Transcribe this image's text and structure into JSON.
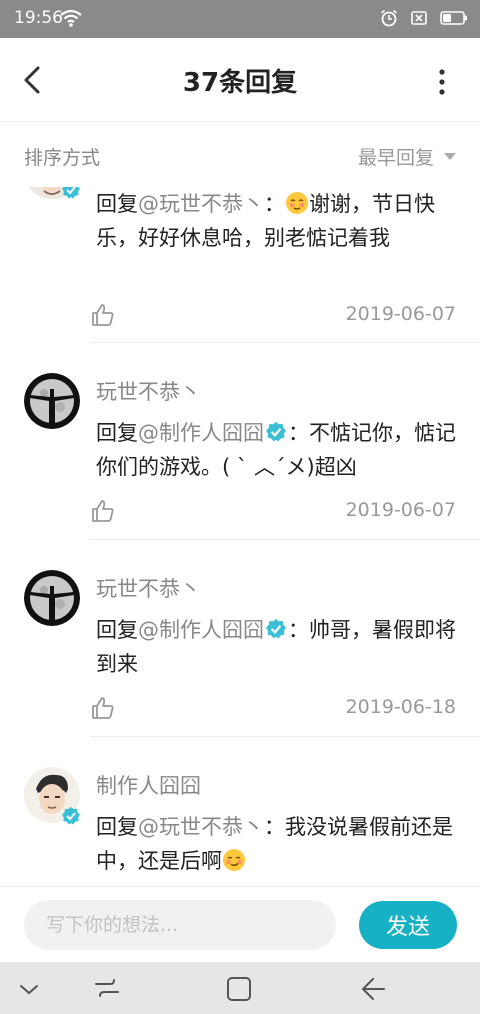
{
  "status": {
    "time": "19:56"
  },
  "header": {
    "title": "37条回复"
  },
  "sort": {
    "label": "排序方式",
    "selected": "最早回复"
  },
  "comments": [
    {
      "body_prefix": "回复",
      "mention": "@玩世不恭丶",
      "body_sep": "：",
      "body_text_line1": "谢谢，节",
      "body_text_rest": "日快乐，好好休息哈，别老惦记着我",
      "date": "2019-06-07"
    },
    {
      "author": "玩世不恭丶",
      "body_prefix": "回复",
      "mention": "@制作人囧囧",
      "body_sep": "：",
      "body_text": "不惦记你，惦记你们的游戏。( ˋ ︿ˊメ)超凶",
      "date": "2019-06-07"
    },
    {
      "author": "玩世不恭丶",
      "body_prefix": "回复",
      "mention": "@制作人囧囧",
      "body_sep": "：",
      "body_text": "帅哥，暑假即将到来",
      "date": "2019-06-18"
    },
    {
      "author": "制作人囧囧",
      "body_prefix": "回复",
      "mention": "@玩世不恭丶",
      "body_sep": "：",
      "body_text": "我没说暑假前还是中，还是后啊"
    }
  ],
  "composer": {
    "placeholder": "写下你的想法...",
    "send_label": "发送"
  },
  "colors": {
    "accent": "#17b1c6",
    "status_bar": "#8a8a8a",
    "verified": "#3bbfd6"
  }
}
